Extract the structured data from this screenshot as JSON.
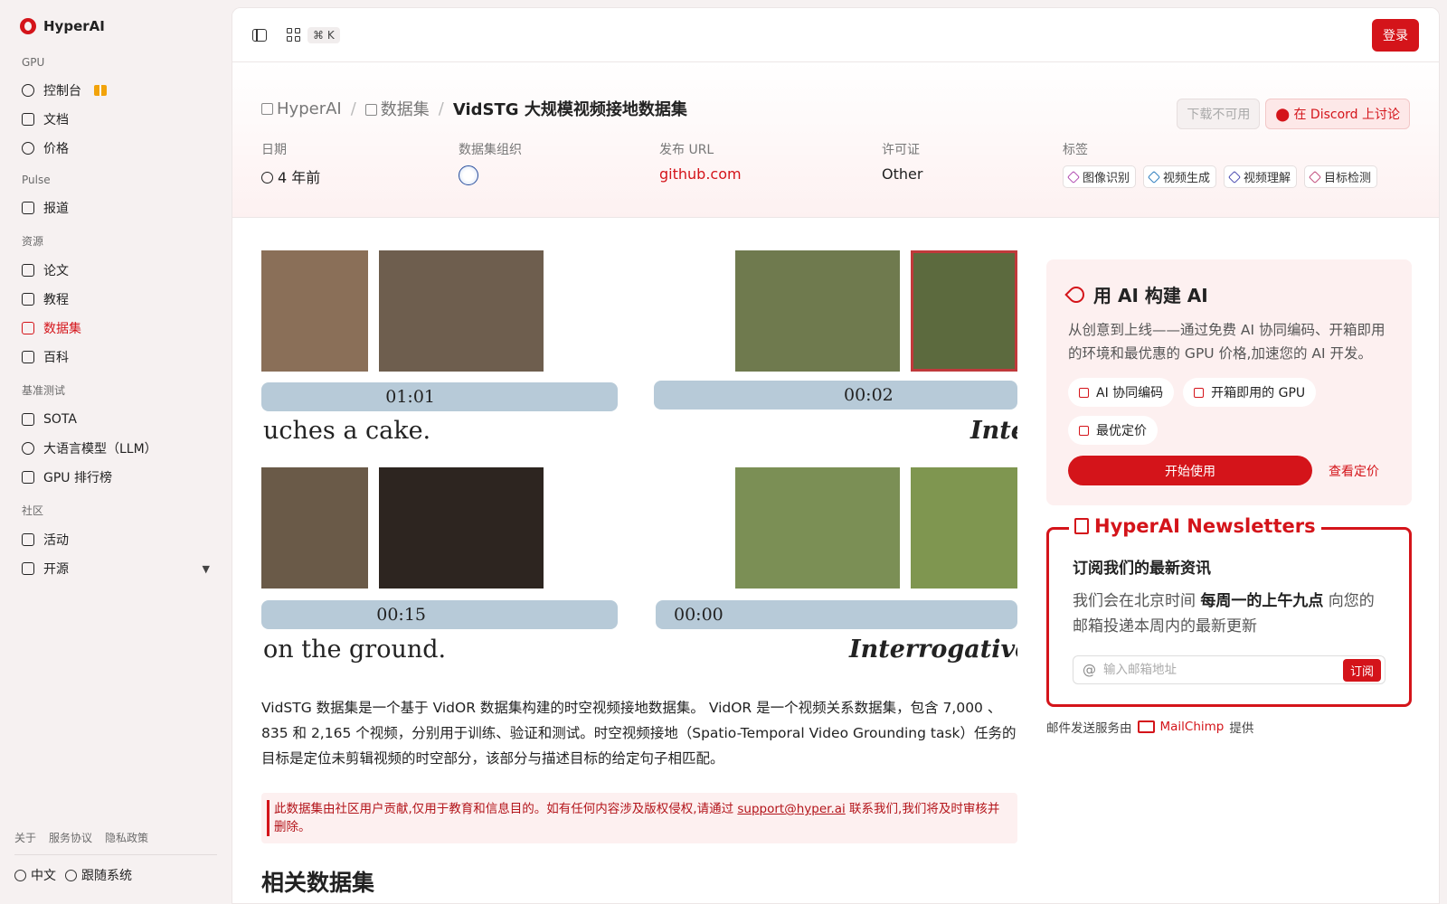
{
  "brand": {
    "name": "HyperAI"
  },
  "sidebar": {
    "sections": [
      {
        "title": "GPU",
        "items": [
          {
            "label": "控制台"
          },
          {
            "label": "文档"
          },
          {
            "label": "价格"
          }
        ]
      },
      {
        "title": "Pulse",
        "items": [
          {
            "label": "报道"
          }
        ]
      },
      {
        "title": "资源",
        "items": [
          {
            "label": "论文"
          },
          {
            "label": "教程"
          },
          {
            "label": "数据集"
          },
          {
            "label": "百科"
          }
        ]
      },
      {
        "title": "基准测试",
        "items": [
          {
            "label": "SOTA"
          },
          {
            "label": "大语言模型（LLM）"
          },
          {
            "label": "GPU 排行榜"
          }
        ]
      },
      {
        "title": "社区",
        "items": [
          {
            "label": "活动"
          },
          {
            "label": "开源"
          }
        ]
      }
    ],
    "active_item": "数据集",
    "footer_links": [
      "关于",
      "服务协议",
      "隐私政策"
    ],
    "language": "中文",
    "theme": "跟随系统"
  },
  "topbar": {
    "shortcut": "⌘ K",
    "login_label": "登录"
  },
  "header": {
    "breadcrumbs": [
      "HyperAI",
      "数据集",
      "VidSTG 大规模视频接地数据集"
    ],
    "download_label": "下载不可用",
    "discord_label": "在 Discord 上讨论",
    "meta": {
      "date_label": "日期",
      "date_value": "4 年前",
      "org_label": "数据集组织",
      "url_label": "发布 URL",
      "url_value": "github.com",
      "license_label": "许可证",
      "license_value": "Other",
      "tags_label": "标签",
      "tags": [
        "图像识别",
        "视频生成",
        "视频理解",
        "目标检测"
      ]
    }
  },
  "figure": {
    "timestamps": [
      "01:01",
      "00:02",
      "00:15",
      "00:00"
    ],
    "captions": [
      "uches a cake.",
      "Inte",
      "on the ground.",
      "Interrogative"
    ]
  },
  "content": {
    "description": "VidSTG 数据集是一个基于 VidOR 数据集构建的时空视频接地数据集。 VidOR 是一个视频关系数据集，包含 7,000 、 835 和 2,165 个视频，分别用于训练、验证和测试。时空视频接地（Spatio-Temporal Video Grounding task）任务的目标是定位未剪辑视频的时空部分，该部分与描述目标的给定句子相匹配。",
    "notice_before": "此数据集由社区用户贡献,仅用于教育和信息目的。如有任何内容涉及版权侵权,请通过 ",
    "notice_email": "support@hyper.ai",
    "notice_after": " 联系我们,我们将及时审核并删除。",
    "related_heading": "相关数据集"
  },
  "ai_card": {
    "title": "用 AI 构建 AI",
    "text": "从创意到上线——通过免费 AI 协同编码、开箱即用的环境和最优惠的 GPU 价格,加速您的 AI 开发。",
    "chips": [
      "AI 协同编码",
      "开箱即用的 GPU",
      "最优定价"
    ],
    "start_label": "开始使用",
    "pricing_label": "查看定价"
  },
  "newsletter": {
    "legend": "HyperAI Newsletters",
    "heading": "订阅我们的最新资讯",
    "text_before": "我们会在北京时间 ",
    "text_bold": "每周一的上午九点",
    "text_after": " 向您的邮箱投递本周内的最新更新",
    "email_placeholder": "输入邮箱地址",
    "subscribe_label": "订阅",
    "provider_before": "邮件发送服务由",
    "provider_name": "MailChimp",
    "provider_after": "提供"
  },
  "colors": {
    "accent": "#d4141a",
    "sidebar_bg": "#f6f1f1"
  }
}
